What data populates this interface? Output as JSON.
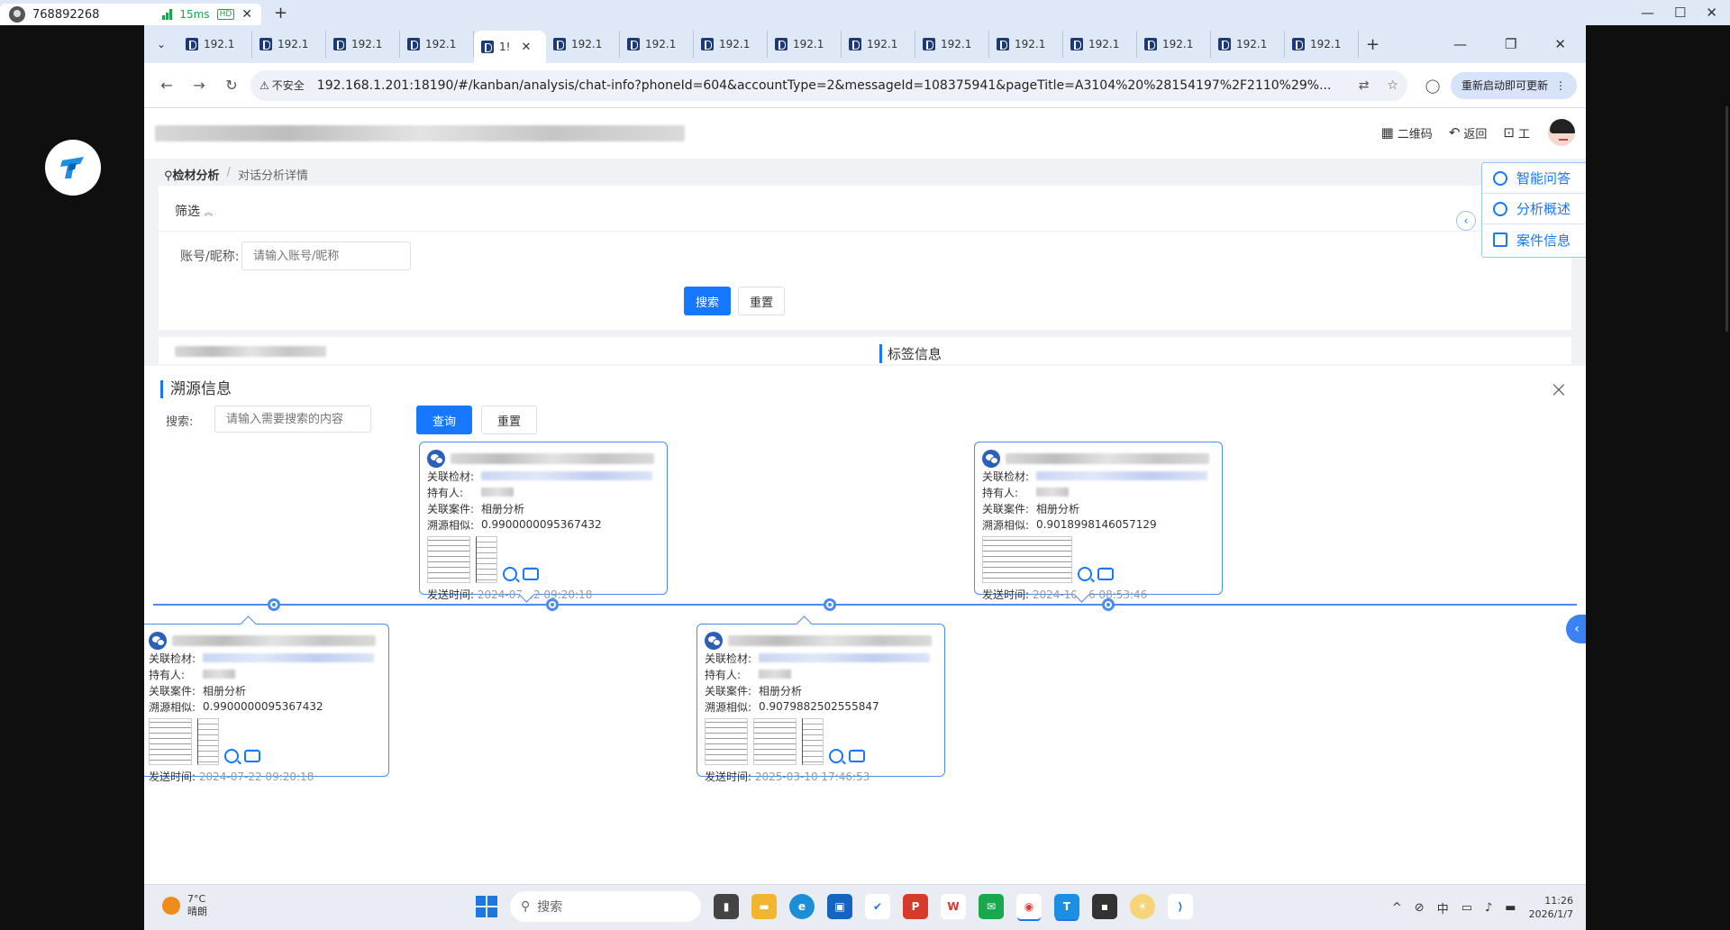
{
  "remote": {
    "session_id": "768892268",
    "latency": "15ms",
    "hd": "HD",
    "close": "✕",
    "add": "+",
    "minimize": "—",
    "restore": "☐",
    "close_win": "✕"
  },
  "browser": {
    "tabs": [
      "192.1",
      "192.1",
      "192.1",
      "192.1",
      "1!",
      "192.1",
      "192.1",
      "192.1",
      "192.1",
      "192.1",
      "192.1",
      "192.1",
      "192.1",
      "192.1",
      "192.1",
      "192.1"
    ],
    "active_tab_index": 4,
    "new_tab": "+",
    "minimize": "—",
    "restore": "❐",
    "close": "✕",
    "security_label": "不安全",
    "url": "192.168.1.201:18190/#/kanban/analysis/chat-info?phoneId=604&accountType=2&messageId=108375941&pageTitle=A3104%20%28154197%2F2110%29%...",
    "update_button": "重新启动即可更新"
  },
  "header": {
    "qrcode_label": "二维码",
    "back_label": "返回",
    "tool_label": "工"
  },
  "breadcrumb": {
    "root": "检材分析",
    "separator": "/",
    "current": "对话分析详情"
  },
  "filter": {
    "title": "筛选",
    "account_label": "账号/昵称:",
    "account_placeholder": "请输入账号/昵称",
    "search_button": "搜索",
    "reset_button": "重置"
  },
  "side_panel": {
    "items": [
      {
        "label": "智能问答",
        "icon": "robot-icon"
      },
      {
        "label": "分析概述",
        "icon": "analysis-icon"
      },
      {
        "label": "案件信息",
        "icon": "case-icon"
      }
    ],
    "collapse": "‹"
  },
  "under_row": {
    "right_title": "标签信息"
  },
  "modal": {
    "title": "溯源信息",
    "close": "×",
    "search_label": "搜索:",
    "search_placeholder": "请输入需要搜索的内容",
    "query_button": "查询",
    "reset_button": "重置",
    "expand": "‹"
  },
  "cards": [
    {
      "label_material": "关联检材:",
      "label_holder": "持有人:",
      "label_case": "关联案件:",
      "case": "相册分析",
      "label_similarity": "溯源相似:",
      "similarity": "0.9900000095367432",
      "label_time": "发送时间:",
      "time": "2024-07-22 09:20:18"
    },
    {
      "label_material": "关联检材:",
      "label_holder": "持有人:",
      "label_case": "关联案件:",
      "case": "相册分析",
      "label_similarity": "溯源相似:",
      "similarity": "0.9018998146057129",
      "label_time": "发送时间:",
      "time": "2024-10-06 08:53:46"
    },
    {
      "label_material": "关联检材:",
      "label_holder": "持有人:",
      "label_case": "关联案件:",
      "case": "相册分析",
      "label_similarity": "溯源相似:",
      "similarity": "0.9900000095367432",
      "label_time": "发送时间:",
      "time": "2024-07-22 09:20:18"
    },
    {
      "label_material": "关联检材:",
      "label_holder": "持有人:",
      "label_case": "关联案件:",
      "case": "相册分析",
      "label_similarity": "溯源相似:",
      "similarity": "0.9079882502555847",
      "label_time": "发送时间:",
      "time": "2025-03-10 17:46:53"
    }
  ],
  "taskbar": {
    "temperature": "7°C",
    "weather": "晴朗",
    "search_label": "搜索",
    "ime": "中",
    "time": "11:26",
    "date": "2026/1/7"
  },
  "colors": {
    "primary": "#1677ff",
    "timeline": "#4a8df0"
  }
}
